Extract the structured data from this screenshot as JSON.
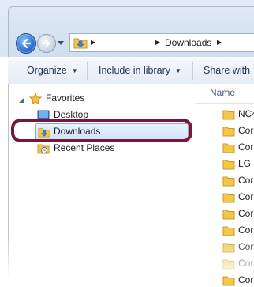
{
  "address": {
    "segments": [
      "Downloads"
    ]
  },
  "toolbar": {
    "organize": "Organize",
    "include_in_library": "Include in library",
    "share_with": "Share with"
  },
  "navigation": {
    "favorites": "Favorites",
    "items": [
      {
        "label": "Desktop",
        "icon": "desktop-icon"
      },
      {
        "label": "Downloads",
        "icon": "downloads-folder-icon",
        "selected": true
      },
      {
        "label": "Recent Places",
        "icon": "recent-places-icon"
      }
    ]
  },
  "file_list": {
    "column_name": "Name",
    "rows": [
      {
        "name": "NC4"
      },
      {
        "name": "Cor"
      },
      {
        "name": "Cor"
      },
      {
        "name": "LG S"
      },
      {
        "name": "Cor"
      },
      {
        "name": "Cor"
      },
      {
        "name": "Cor"
      },
      {
        "name": "Cor"
      },
      {
        "name": "Cor"
      },
      {
        "name": "Cor"
      },
      {
        "name": "Cor"
      }
    ]
  },
  "colors": {
    "highlight_ring": "#7a1636",
    "selection_fill": "#cfe3fb",
    "folder_yellow": "#f2c84b"
  }
}
